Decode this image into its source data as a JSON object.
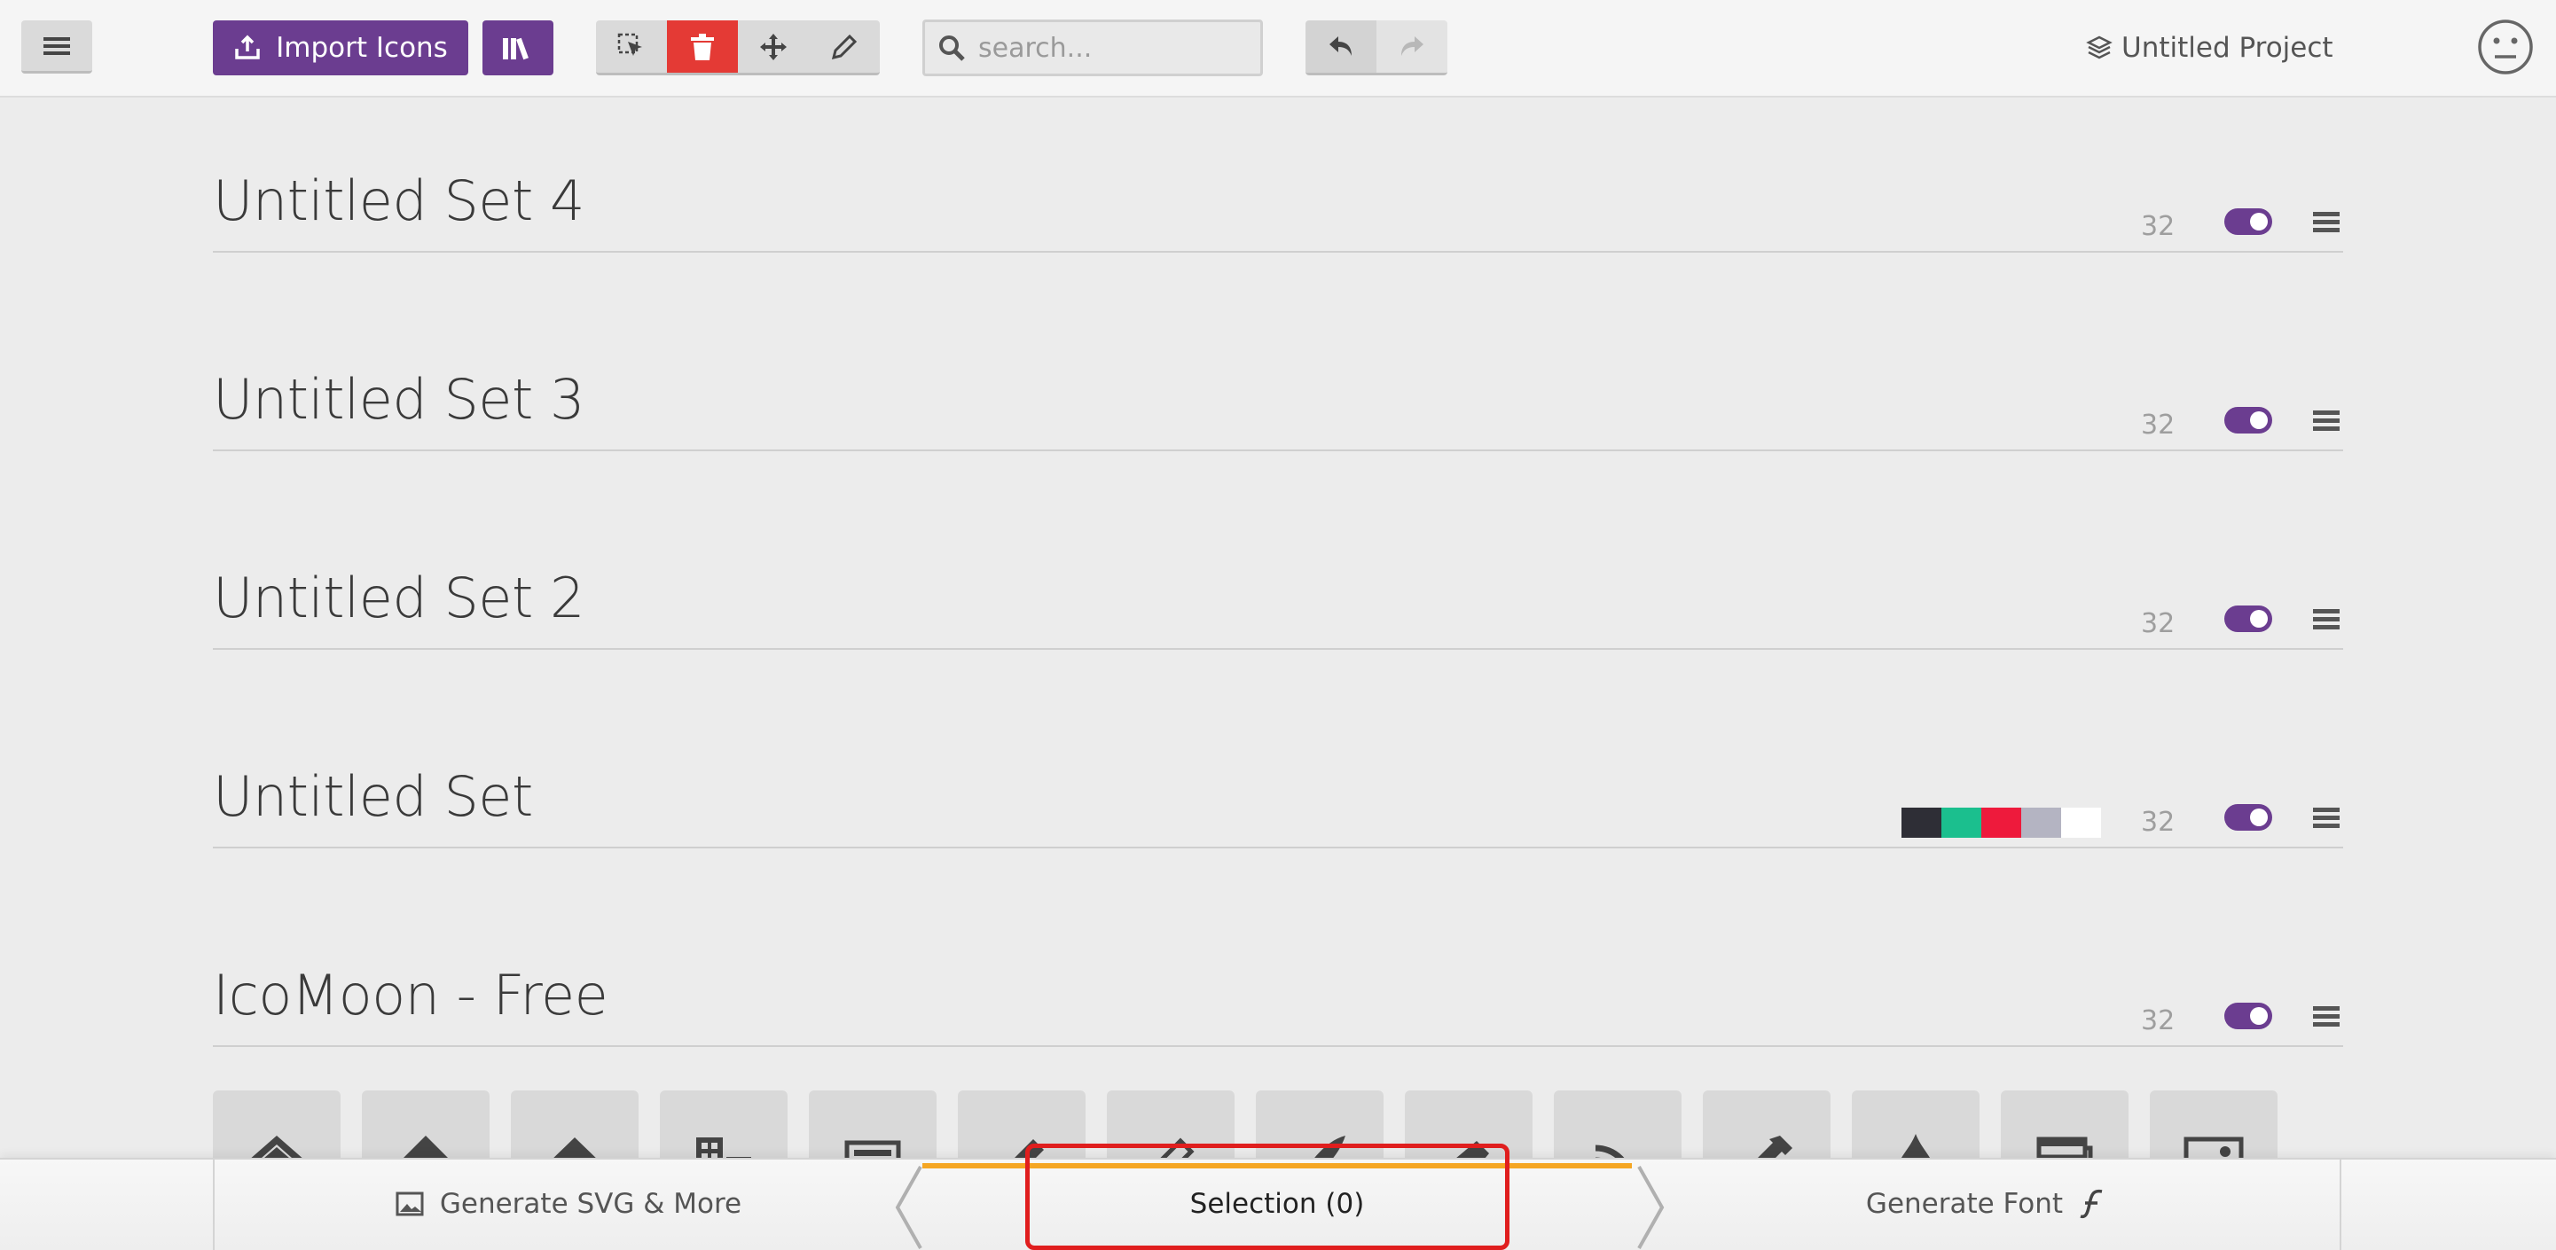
{
  "toolbar": {
    "import_label": "Import Icons",
    "search_placeholder": "search...",
    "project_label": "Untitled Project"
  },
  "sets": [
    {
      "title": "Untitled Set 4",
      "size": "32"
    },
    {
      "title": "Untitled Set 3",
      "size": "32"
    },
    {
      "title": "Untitled Set 2",
      "size": "32"
    },
    {
      "title": "Untitled Set",
      "size": "32",
      "swatches": [
        "#2e2e36",
        "#1bbf8e",
        "#ee1a3c",
        "#b4b4c2",
        "#ffffff"
      ]
    },
    {
      "title": "IcoMoon - Free",
      "size": "32"
    }
  ],
  "icons": [
    "home-icon",
    "home2-icon",
    "home3-icon",
    "office-icon",
    "newspaper-icon",
    "pencil-icon",
    "pencil2-icon",
    "quill-icon",
    "pen-icon",
    "blog-icon",
    "eyedropper-icon",
    "droplet-icon",
    "paint-format-icon",
    "image-icon"
  ],
  "bottom": {
    "svg_label": "Generate SVG & More",
    "selection_label": "Selection (0)",
    "font_label": "Generate Font"
  },
  "colors": {
    "accent": "#6b3d90",
    "delete_active": "#e43a35",
    "progress": "#f5a623",
    "highlight": "#e01e1e"
  }
}
